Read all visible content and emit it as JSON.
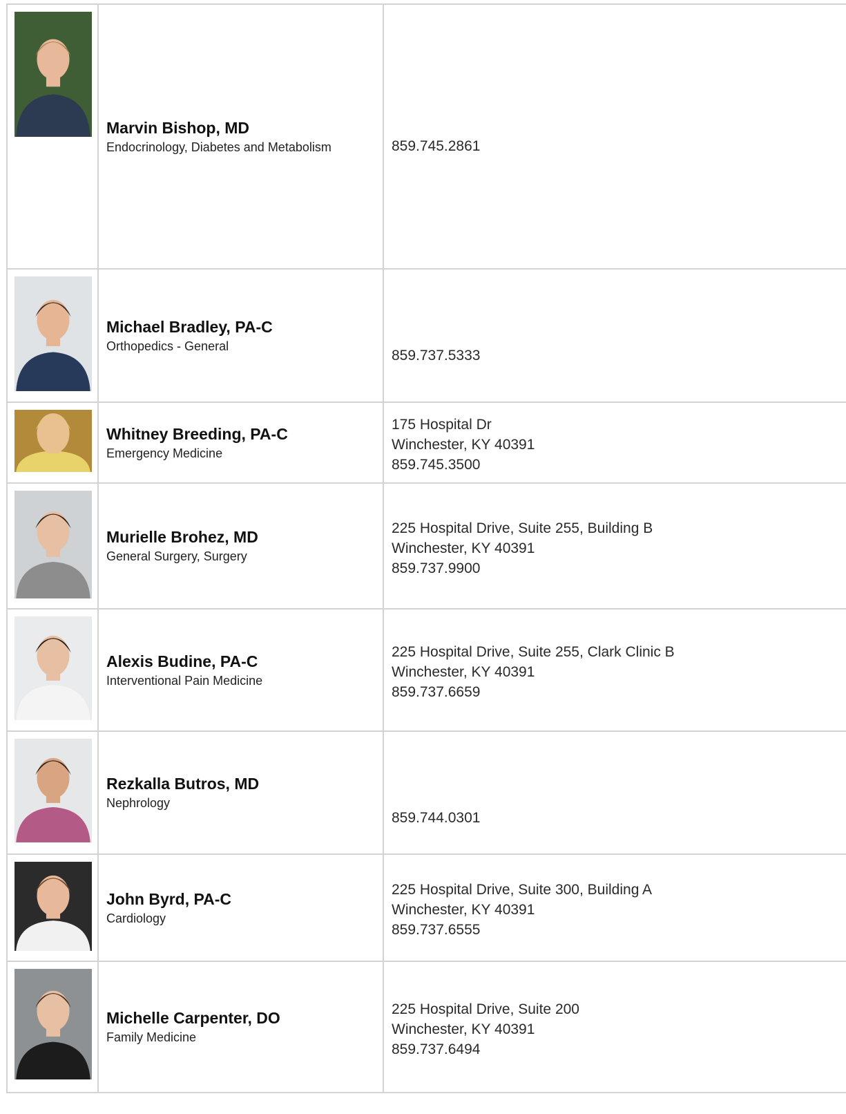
{
  "providers": [
    {
      "name": "Marvin Bishop, MD",
      "specialty": "Endocrinology, Diabetes and Metabolism",
      "address1": "",
      "address2": "",
      "phone": "859.745.2861",
      "photo": {
        "bg": "#3f5e35",
        "shirt": "#2c3a52",
        "skin": "#e8b89a",
        "hair": "#b08a55"
      }
    },
    {
      "name": "Michael Bradley, PA-C",
      "specialty": "Orthopedics - General",
      "address1": "",
      "address2": "",
      "phone": "859.737.5333",
      "photo": {
        "bg": "#dfe3e6",
        "shirt": "#283a5a",
        "skin": "#e6b593",
        "hair": "#3a2a1e"
      }
    },
    {
      "name": "Whitney Breeding, PA-C",
      "specialty": "Emergency Medicine",
      "address1": "175 Hospital Dr",
      "address2": "Winchester, KY 40391",
      "phone": "859.745.3500",
      "photo": {
        "bg": "#b28a3a",
        "shirt": "#e8d36a",
        "skin": "#e9c08f",
        "hair": "#e2c97e"
      }
    },
    {
      "name": "Murielle Brohez, MD",
      "specialty": "General Surgery, Surgery",
      "address1": "225 Hospital Drive, Suite 255, Building B",
      "address2": "Winchester, KY 40391",
      "phone": "859.737.9900",
      "photo": {
        "bg": "#cfd2d4",
        "shirt": "#8d8d8d",
        "skin": "#e7bfa3",
        "hair": "#2a201a"
      }
    },
    {
      "name": "Alexis Budine, PA-C",
      "specialty": "Interventional Pain Medicine",
      "address1": "225 Hospital Drive, Suite 255, Clark Clinic B",
      "address2": "Winchester, KY 40391",
      "phone": "859.737.6659",
      "photo": {
        "bg": "#e9ebec",
        "shirt": "#f4f4f4",
        "skin": "#e7bfa3",
        "hair": "#1e1714"
      }
    },
    {
      "name": "Rezkalla Butros, MD",
      "specialty": "Nephrology",
      "address1": "",
      "address2": "",
      "phone": "859.744.0301",
      "photo": {
        "bg": "#e5e7e8",
        "shirt": "#b45a86",
        "skin": "#d9a482",
        "hair": "#2a1f18"
      }
    },
    {
      "name": "John Byrd, PA-C",
      "specialty": "Cardiology",
      "address1": "225 Hospital Drive, Suite 300, Building A",
      "address2": "Winchester, KY 40391",
      "phone": "859.737.6555",
      "photo": {
        "bg": "#2b2b2b",
        "shirt": "#f1f1f1",
        "skin": "#e8b89a",
        "hair": "#6a4a2a"
      }
    },
    {
      "name": "Michelle Carpenter, DO",
      "specialty": "Family Medicine",
      "address1": "225 Hospital Drive, Suite 200",
      "address2": "Winchester, KY 40391",
      "phone": "859.737.6494",
      "photo": {
        "bg": "#8e9194",
        "shirt": "#1c1c1c",
        "skin": "#e7bfa3",
        "hair": "#4a3020"
      }
    }
  ]
}
